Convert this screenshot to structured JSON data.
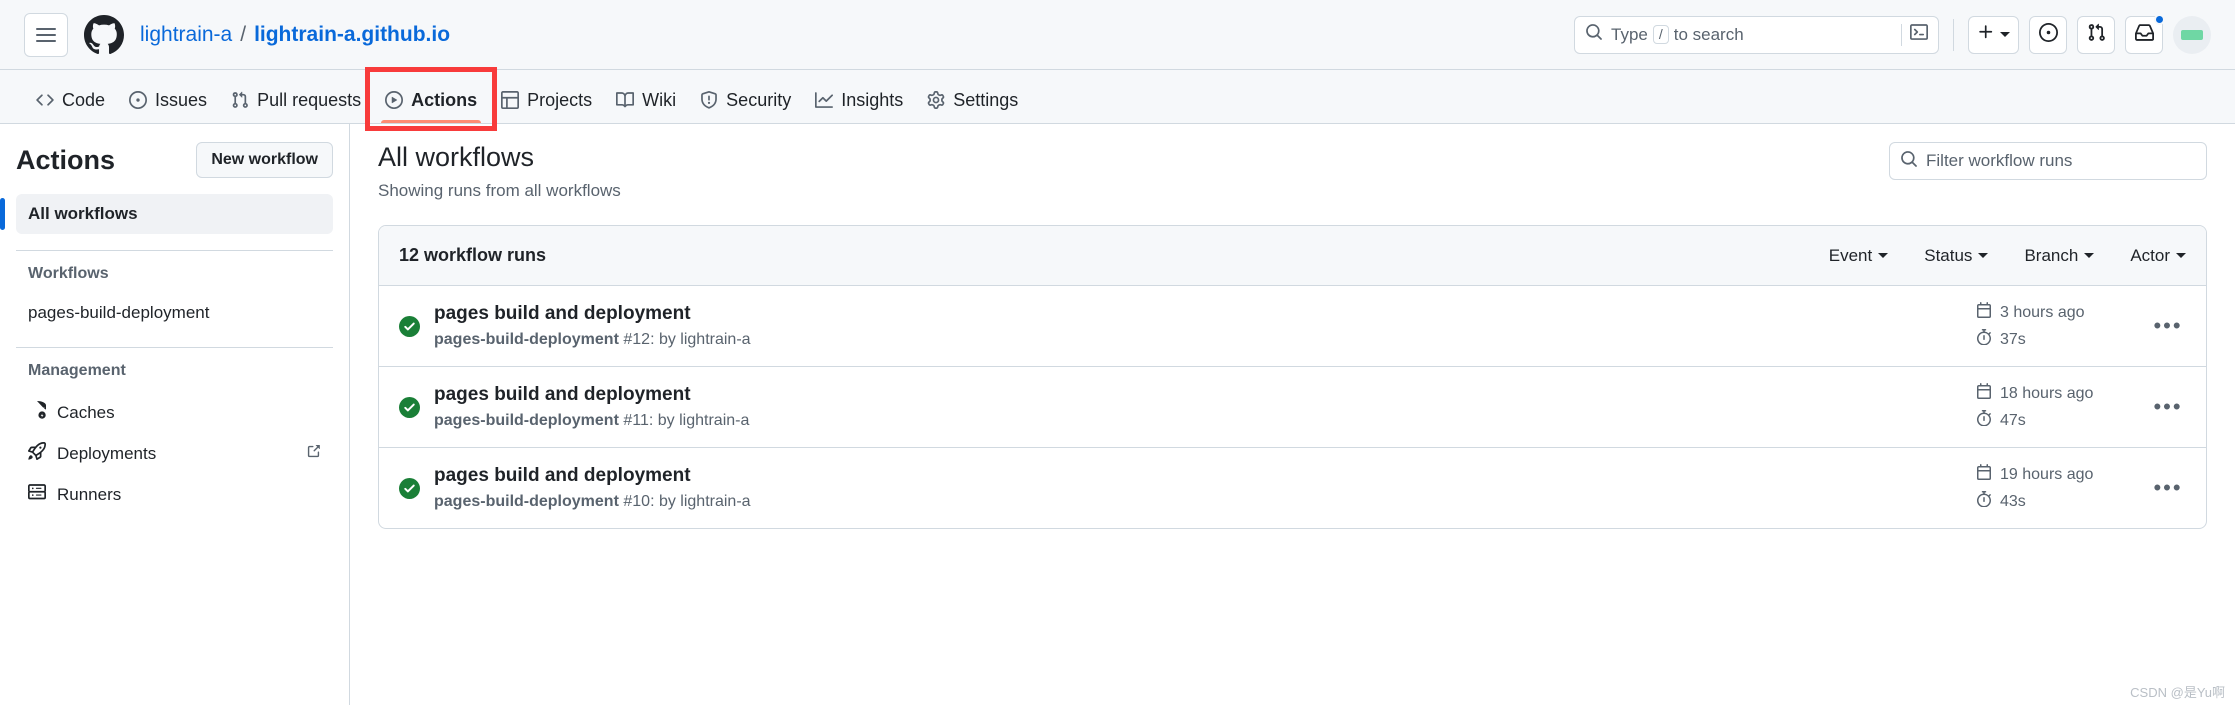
{
  "header": {
    "menu_icon": "hamburger-icon",
    "logo_icon": "github-logo-icon",
    "breadcrumb": {
      "owner": "lightrain-a",
      "separator": "/",
      "repo": "lightrain-a.github.io"
    },
    "search": {
      "icon": "search-icon",
      "prefix": "Type",
      "slash_key": "/",
      "suffix": "to search",
      "command_icon": "terminal-icon"
    },
    "actions": {
      "create_new_label": "+",
      "create_new_icon": "plus-icon",
      "create_new_caret": "chevron-down-icon",
      "issues_icon": "issue-opened-icon",
      "pull_requests_icon": "git-pull-request-icon",
      "inbox_icon": "inbox-icon",
      "avatar_icon": "user-avatar"
    }
  },
  "repo_nav": {
    "tabs": [
      {
        "label": "Code",
        "icon": "code-icon",
        "active": false
      },
      {
        "label": "Issues",
        "icon": "issue-opened-icon",
        "active": false
      },
      {
        "label": "Pull requests",
        "icon": "git-pull-request-icon",
        "active": false
      },
      {
        "label": "Actions",
        "icon": "play-icon",
        "active": true
      },
      {
        "label": "Projects",
        "icon": "table-icon",
        "active": false
      },
      {
        "label": "Wiki",
        "icon": "book-icon",
        "active": false
      },
      {
        "label": "Security",
        "icon": "shield-icon",
        "active": false
      },
      {
        "label": "Insights",
        "icon": "graph-icon",
        "active": false
      },
      {
        "label": "Settings",
        "icon": "gear-icon",
        "active": false
      }
    ],
    "annotation_color": "#f83b3b",
    "active_underline_color": "#fd8c73"
  },
  "sidebar": {
    "title": "Actions",
    "new_workflow_button": "New workflow",
    "all_workflows": "All workflows",
    "workflows_group_label": "Workflows",
    "workflows": [
      {
        "name": "pages-build-deployment"
      }
    ],
    "management_group_label": "Management",
    "management_items": [
      {
        "label": "Caches",
        "icon": "cache-database-icon",
        "external": false
      },
      {
        "label": "Deployments",
        "icon": "rocket-icon",
        "external": true
      },
      {
        "label": "Runners",
        "icon": "server-icon",
        "external": false
      }
    ]
  },
  "main": {
    "title": "All workflows",
    "subtitle": "Showing runs from all workflows",
    "filter_placeholder": "Filter workflow runs",
    "filter_icon": "search-icon",
    "runs_count_label": "12 workflow runs",
    "filters": [
      {
        "label": "Event"
      },
      {
        "label": "Status"
      },
      {
        "label": "Branch"
      },
      {
        "label": "Actor"
      }
    ],
    "runs": [
      {
        "status": "success",
        "status_icon": "check-circle-icon",
        "title": "pages build and deployment",
        "workflow": "pages-build-deployment",
        "run_number": "#12",
        "by": ": by lightrain-a",
        "date_icon": "calendar-icon",
        "date": "3 hours ago",
        "duration_icon": "stopwatch-icon",
        "duration": "37s",
        "menu_icon": "kebab-horizontal-icon",
        "menu_glyph": "•••"
      },
      {
        "status": "success",
        "status_icon": "check-circle-icon",
        "title": "pages build and deployment",
        "workflow": "pages-build-deployment",
        "run_number": "#11",
        "by": ": by lightrain-a",
        "date_icon": "calendar-icon",
        "date": "18 hours ago",
        "duration_icon": "stopwatch-icon",
        "duration": "47s",
        "menu_icon": "kebab-horizontal-icon",
        "menu_glyph": "•••"
      },
      {
        "status": "success",
        "status_icon": "check-circle-icon",
        "title": "pages build and deployment",
        "workflow": "pages-build-deployment",
        "run_number": "#10",
        "by": ": by lightrain-a",
        "date_icon": "calendar-icon",
        "date": "19 hours ago",
        "duration_icon": "stopwatch-icon",
        "duration": "43s",
        "menu_icon": "kebab-horizontal-icon",
        "menu_glyph": "•••"
      }
    ]
  },
  "watermark": "CSDN @是Yu啊",
  "colors": {
    "accent": "#0969da",
    "success": "#1a7f37",
    "active_tab_underline": "#fd8c73",
    "annotation": "#f83b3b",
    "header_bg": "#f6f8fa",
    "border": "#d1d9e0",
    "muted_text": "#59636e"
  }
}
